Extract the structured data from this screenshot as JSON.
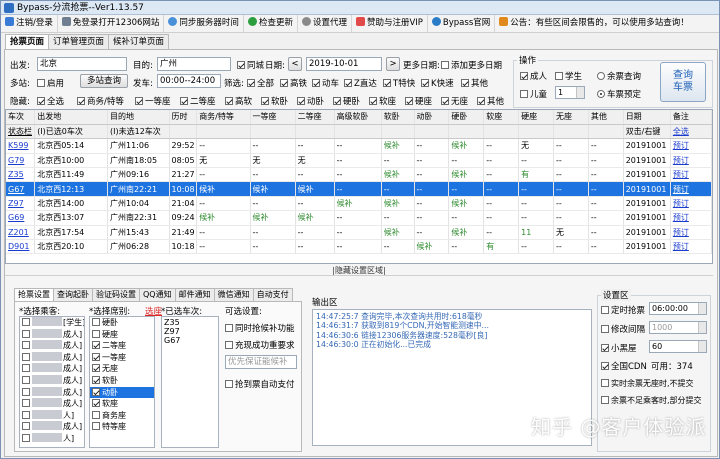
{
  "title": "Bypass-分流抢票--Ver1.13.57",
  "menu": {
    "login": "注销/登录",
    "free": "免登录打开12306网站",
    "sync": "同步服务器时间",
    "update": "检查更新",
    "proxy": "设置代理",
    "vip": "赞助与注册VIP",
    "site": "Bypass官网",
    "notice": "公告：有些区间会限售的，可以使用多站查询！"
  },
  "tabs": [
    "抢票页面",
    "订单管理页面",
    "候补订单页面"
  ],
  "search": {
    "from_label": "出发:",
    "from": "北京",
    "to_label": "目的:",
    "to": "广州",
    "same_city": "同城",
    "date_label": "日期:",
    "date": "2019-10-01",
    "more_dates_label": "更多日期:",
    "add_dates": "添加更多日期",
    "multi_label": "多站:",
    "enable": "启用",
    "multi_btn": "多站查询",
    "depart_label": "发车:",
    "depart_time": "00:00--24:00",
    "filter_label": "筛选:",
    "hide_label": "隐藏:",
    "ops_label": "操作"
  },
  "filters": [
    "全部",
    "高铁",
    "动车",
    "Z直达",
    "T特快",
    "K快速",
    "其他"
  ],
  "hide_items": [
    "全选",
    "商务/特等",
    "一等座",
    "二等座",
    "高软",
    "软卧",
    "动卧",
    "硬卧",
    "软座",
    "硬座",
    "无座",
    "其他"
  ],
  "ops": {
    "adult": "成人",
    "student": "学生",
    "child": "儿童",
    "child_count": "1",
    "remaining": "余票查询",
    "booking": "车票预定",
    "query_btn": "查询车票"
  },
  "table": {
    "headers": [
      "车次",
      "出发地",
      "目的地",
      "历时",
      "商务/特等",
      "一等座",
      "二等座",
      "高级软卧",
      "软卧",
      "动卧",
      "硬卧",
      "软座",
      "硬座",
      "无座",
      "其他",
      "日期",
      "备注"
    ],
    "subheaders": [
      "状态栏",
      "(I)已选0车次",
      "(I)未选12车次",
      "",
      "",
      "",
      "",
      "",
      "",
      "",
      "",
      "",
      "",
      "",
      "",
      "双击/右键",
      "全选"
    ],
    "rows": [
      [
        "K599",
        "北京西05:14",
        "广州11:06",
        "29:52",
        "--",
        "--",
        "--",
        "--",
        "候补",
        "--",
        "候补",
        "--",
        "无",
        "--",
        "--",
        "20191001",
        "预订"
      ],
      [
        "G79",
        "北京西10:00",
        "广州南18:05",
        "08:05",
        "无",
        "无",
        "无",
        "--",
        "--",
        "--",
        "--",
        "--",
        "--",
        "--",
        "--",
        "20191001",
        "预订"
      ],
      [
        "Z35",
        "北京西11:49",
        "广州09:16",
        "21:27",
        "--",
        "--",
        "--",
        "--",
        "候补",
        "--",
        "候补",
        "--",
        "有",
        "--",
        "--",
        "20191001",
        "预订"
      ],
      [
        "G67",
        "北京西12:13",
        "广州南22:21",
        "10:08",
        "候补",
        "候补",
        "候补",
        "--",
        "--",
        "--",
        "--",
        "--",
        "--",
        "--",
        "--",
        "20191001",
        "预订"
      ],
      [
        "Z97",
        "北京西14:00",
        "广州10:04",
        "21:04",
        "--",
        "--",
        "--",
        "候补",
        "候补",
        "--",
        "候补",
        "--",
        "--",
        "--",
        "--",
        "20191001",
        "预订"
      ],
      [
        "G69",
        "北京西13:07",
        "广州南22:31",
        "09:24",
        "候补",
        "候补",
        "候补",
        "--",
        "--",
        "--",
        "--",
        "--",
        "--",
        "--",
        "--",
        "20191001",
        "预订"
      ],
      [
        "Z201",
        "北京西17:54",
        "广州15:43",
        "21:49",
        "--",
        "--",
        "--",
        "--",
        "候补",
        "--",
        "候补",
        "--",
        "11",
        "无",
        "--",
        "20191001",
        "预订"
      ],
      [
        "D901",
        "北京西20:10",
        "广州06:28",
        "10:18",
        "--",
        "--",
        "--",
        "--",
        "--",
        "候补",
        "--",
        "有",
        "--",
        "--",
        "--",
        "20191001",
        "预订"
      ]
    ]
  },
  "hide_bar": "|隐藏设置区域|",
  "bottom_tabs": [
    "抢票设置",
    "查询起卧",
    "验证码设置",
    "QQ通知",
    "邮件通知",
    "微信通知",
    "自动支付"
  ],
  "passengers": {
    "label": "*选择乘客:",
    "items": [
      "[学生]",
      "成人]",
      "成人]",
      "成人]",
      "成人]",
      "成人]",
      "成人]",
      "成人]",
      "人]",
      "成人]",
      "人]"
    ]
  },
  "seats": {
    "label": "*选择席别:",
    "link": "选座",
    "items": [
      "硬卧",
      "硬座",
      "二等座",
      "一等座",
      "无座",
      "软卧",
      "动卧",
      "软座",
      "商务座",
      "特等座"
    ]
  },
  "trains": {
    "label": "*已选车次:",
    "items": [
      "Z35",
      "Z97",
      "G67"
    ]
  },
  "options": {
    "label": "可选设置:",
    "a": "同时抢候补功能",
    "b": "充现成功重要求",
    "select": "优先保证能候补",
    "c": "抢到票自动支付"
  },
  "output": {
    "label": "输出区",
    "lines": [
      "14:47:25:7  查询完毕,本次查询共用时:618毫秒",
      "14:46:31:7  获取到819个CDN,开始智能测速中...",
      "14:46:30:6  链接12306服务器速度:528毫秒[良]",
      "14:46:30:0  正在初始化...已完成"
    ]
  },
  "settings": {
    "label": "设置区",
    "timed": "定时抢票",
    "timed_val": "06:00:00",
    "interval": "修改间隔",
    "interval_val": "1000",
    "blackhouse": "小黑屋",
    "blackhouse_val": "60",
    "cdn": "全国CDN",
    "cdn_avail": "可用：374",
    "realtime": "实时余票无座时,不提交",
    "partial": "余票不足乘客时,部分提交"
  },
  "watermark": "知乎 @客户体验派"
}
